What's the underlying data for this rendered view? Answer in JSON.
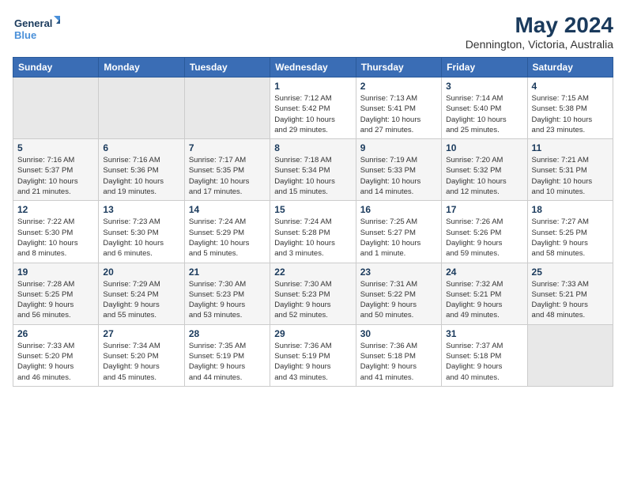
{
  "header": {
    "logo_line1": "General",
    "logo_line2": "Blue",
    "month": "May 2024",
    "location": "Dennington, Victoria, Australia"
  },
  "weekdays": [
    "Sunday",
    "Monday",
    "Tuesday",
    "Wednesday",
    "Thursday",
    "Friday",
    "Saturday"
  ],
  "weeks": [
    [
      {
        "num": "",
        "info": ""
      },
      {
        "num": "",
        "info": ""
      },
      {
        "num": "",
        "info": ""
      },
      {
        "num": "1",
        "info": "Sunrise: 7:12 AM\nSunset: 5:42 PM\nDaylight: 10 hours\nand 29 minutes."
      },
      {
        "num": "2",
        "info": "Sunrise: 7:13 AM\nSunset: 5:41 PM\nDaylight: 10 hours\nand 27 minutes."
      },
      {
        "num": "3",
        "info": "Sunrise: 7:14 AM\nSunset: 5:40 PM\nDaylight: 10 hours\nand 25 minutes."
      },
      {
        "num": "4",
        "info": "Sunrise: 7:15 AM\nSunset: 5:38 PM\nDaylight: 10 hours\nand 23 minutes."
      }
    ],
    [
      {
        "num": "5",
        "info": "Sunrise: 7:16 AM\nSunset: 5:37 PM\nDaylight: 10 hours\nand 21 minutes."
      },
      {
        "num": "6",
        "info": "Sunrise: 7:16 AM\nSunset: 5:36 PM\nDaylight: 10 hours\nand 19 minutes."
      },
      {
        "num": "7",
        "info": "Sunrise: 7:17 AM\nSunset: 5:35 PM\nDaylight: 10 hours\nand 17 minutes."
      },
      {
        "num": "8",
        "info": "Sunrise: 7:18 AM\nSunset: 5:34 PM\nDaylight: 10 hours\nand 15 minutes."
      },
      {
        "num": "9",
        "info": "Sunrise: 7:19 AM\nSunset: 5:33 PM\nDaylight: 10 hours\nand 14 minutes."
      },
      {
        "num": "10",
        "info": "Sunrise: 7:20 AM\nSunset: 5:32 PM\nDaylight: 10 hours\nand 12 minutes."
      },
      {
        "num": "11",
        "info": "Sunrise: 7:21 AM\nSunset: 5:31 PM\nDaylight: 10 hours\nand 10 minutes."
      }
    ],
    [
      {
        "num": "12",
        "info": "Sunrise: 7:22 AM\nSunset: 5:30 PM\nDaylight: 10 hours\nand 8 minutes."
      },
      {
        "num": "13",
        "info": "Sunrise: 7:23 AM\nSunset: 5:30 PM\nDaylight: 10 hours\nand 6 minutes."
      },
      {
        "num": "14",
        "info": "Sunrise: 7:24 AM\nSunset: 5:29 PM\nDaylight: 10 hours\nand 5 minutes."
      },
      {
        "num": "15",
        "info": "Sunrise: 7:24 AM\nSunset: 5:28 PM\nDaylight: 10 hours\nand 3 minutes."
      },
      {
        "num": "16",
        "info": "Sunrise: 7:25 AM\nSunset: 5:27 PM\nDaylight: 10 hours\nand 1 minute."
      },
      {
        "num": "17",
        "info": "Sunrise: 7:26 AM\nSunset: 5:26 PM\nDaylight: 9 hours\nand 59 minutes."
      },
      {
        "num": "18",
        "info": "Sunrise: 7:27 AM\nSunset: 5:25 PM\nDaylight: 9 hours\nand 58 minutes."
      }
    ],
    [
      {
        "num": "19",
        "info": "Sunrise: 7:28 AM\nSunset: 5:25 PM\nDaylight: 9 hours\nand 56 minutes."
      },
      {
        "num": "20",
        "info": "Sunrise: 7:29 AM\nSunset: 5:24 PM\nDaylight: 9 hours\nand 55 minutes."
      },
      {
        "num": "21",
        "info": "Sunrise: 7:30 AM\nSunset: 5:23 PM\nDaylight: 9 hours\nand 53 minutes."
      },
      {
        "num": "22",
        "info": "Sunrise: 7:30 AM\nSunset: 5:23 PM\nDaylight: 9 hours\nand 52 minutes."
      },
      {
        "num": "23",
        "info": "Sunrise: 7:31 AM\nSunset: 5:22 PM\nDaylight: 9 hours\nand 50 minutes."
      },
      {
        "num": "24",
        "info": "Sunrise: 7:32 AM\nSunset: 5:21 PM\nDaylight: 9 hours\nand 49 minutes."
      },
      {
        "num": "25",
        "info": "Sunrise: 7:33 AM\nSunset: 5:21 PM\nDaylight: 9 hours\nand 48 minutes."
      }
    ],
    [
      {
        "num": "26",
        "info": "Sunrise: 7:33 AM\nSunset: 5:20 PM\nDaylight: 9 hours\nand 46 minutes."
      },
      {
        "num": "27",
        "info": "Sunrise: 7:34 AM\nSunset: 5:20 PM\nDaylight: 9 hours\nand 45 minutes."
      },
      {
        "num": "28",
        "info": "Sunrise: 7:35 AM\nSunset: 5:19 PM\nDaylight: 9 hours\nand 44 minutes."
      },
      {
        "num": "29",
        "info": "Sunrise: 7:36 AM\nSunset: 5:19 PM\nDaylight: 9 hours\nand 43 minutes."
      },
      {
        "num": "30",
        "info": "Sunrise: 7:36 AM\nSunset: 5:18 PM\nDaylight: 9 hours\nand 41 minutes."
      },
      {
        "num": "31",
        "info": "Sunrise: 7:37 AM\nSunset: 5:18 PM\nDaylight: 9 hours\nand 40 minutes."
      },
      {
        "num": "",
        "info": ""
      }
    ]
  ]
}
